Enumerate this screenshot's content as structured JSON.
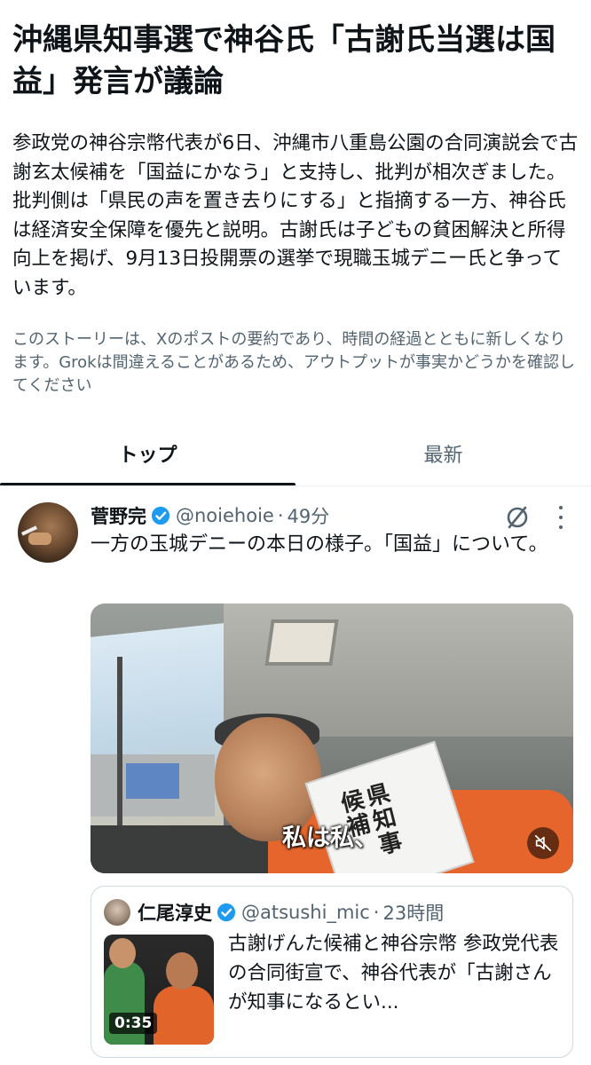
{
  "story": {
    "headline": "沖縄県知事選で神谷氏「古謝氏当選は国益」発言が議論",
    "summary": "参政党の神谷宗幣代表が6日、沖縄市八重島公園の合同演説会で古謝玄太候補を「国益にかなう」と支持し、批判が相次ぎました。批判側は「県民の声を置き去りにする」と指摘する一方、神谷氏は経済安全保障を優先と説明。古謝氏は子どもの貧困解決と所得向上を掲げ、9月13日投開票の選挙で現職玉城デニー氏と争っています。",
    "disclaimer": "このストーリーは、Xのポストの要約であり、時間の経過とともに新しくなります。Grokは間違えることがあるため、アウトプットが事実かどうかを確認してください"
  },
  "tabs": [
    {
      "label": "トップ",
      "active": true
    },
    {
      "label": "最新",
      "active": false
    }
  ],
  "post": {
    "author": "菅野完",
    "handle": "@noiehoie",
    "separator": "·",
    "time": "49分",
    "text": "一方の玉城デニーの本日の様子。「国益」について。",
    "media": {
      "caption": "私は私、",
      "sash_text": "県知事候補",
      "muted": true
    }
  },
  "quote": {
    "author": "仁尾淳史",
    "handle": "@atsushi_mic",
    "separator": "·",
    "time": "23時間",
    "duration": "0:35",
    "text": "古謝げんた候補と神谷宗幣 参政党代表の合同街宣で、神谷代表が「古謝さんが知事になるとい..."
  },
  "colors": {
    "text_primary": "#0f1419",
    "text_secondary": "#536471",
    "verified_blue": "#1d9bf0",
    "border": "#cfd9de"
  }
}
